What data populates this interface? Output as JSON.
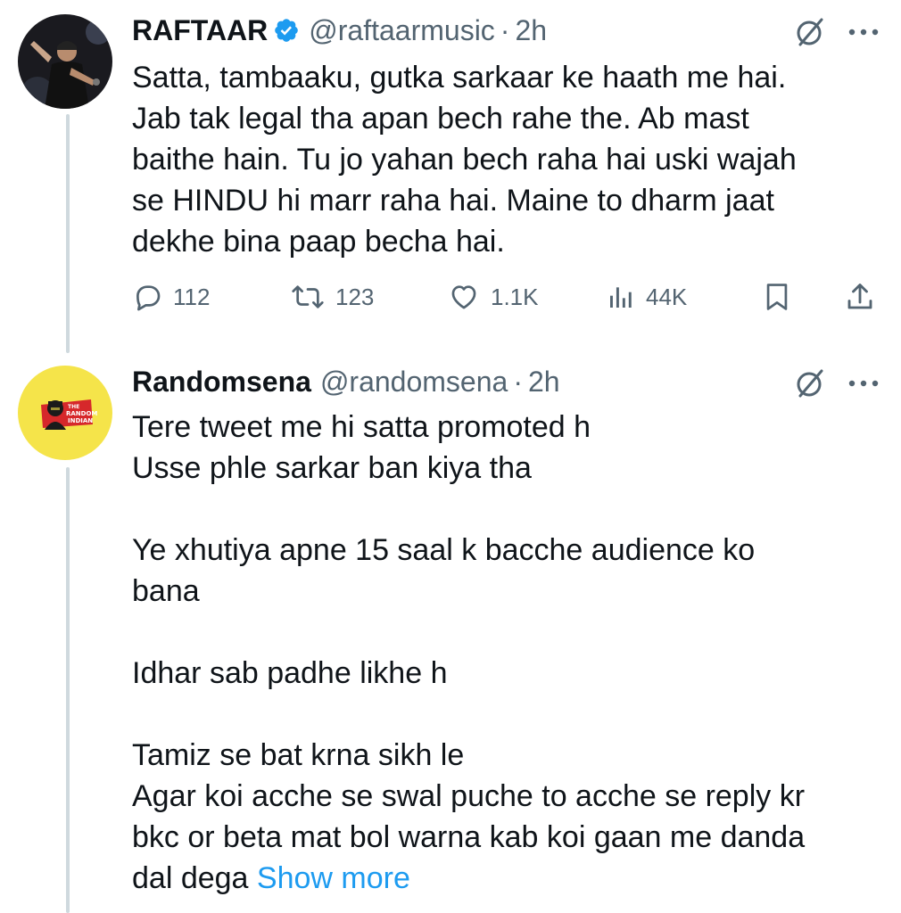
{
  "tweets": [
    {
      "display_name": "RAFTAAR",
      "handle": "@raftaarmusic",
      "separator": "·",
      "time": "2h",
      "verified": true,
      "avatar_icon": "performer-photo",
      "lines": [
        "Satta, tambaaku, gutka sarkaar ke haath me hai.",
        "Jab tak legal tha apan bech rahe the. Ab mast",
        "baithe hain. Tu jo yahan bech raha hai uski wajah",
        "se HINDU hi marr raha hai. Maine to dharm jaat",
        "dekhe bina paap becha hai."
      ],
      "actions": {
        "replies": "112",
        "reposts": "123",
        "likes": "1.1K",
        "views": "44K"
      }
    },
    {
      "display_name": "Randomsena",
      "handle": "@randomsena",
      "separator": "·",
      "time": "2h",
      "verified": false,
      "avatar_icon": "the-random-indian-logo",
      "avatar_logo_text": [
        "THE",
        "RANDOM",
        "INDIAN"
      ],
      "lines": [
        "Tere tweet me hi satta promoted h",
        "Usse phle sarkar ban kiya tha",
        "",
        "Ye xhutiya apne 15 saal k bacche audience ko",
        "bana",
        "",
        "Idhar sab padhe likhe h",
        "",
        "Tamiz se bat krna sikh le",
        "Agar koi acche se swal puche to acche se reply kr",
        "bkc or beta mat bol warna kab koi gaan me danda",
        "dal dega"
      ],
      "show_more": "Show more"
    }
  ],
  "colors": {
    "text": "#0f1419",
    "secondary": "#536471",
    "link": "#1d9bf0",
    "thread_line": "#cfd9de",
    "avatar_yellow": "#f5e44a"
  }
}
